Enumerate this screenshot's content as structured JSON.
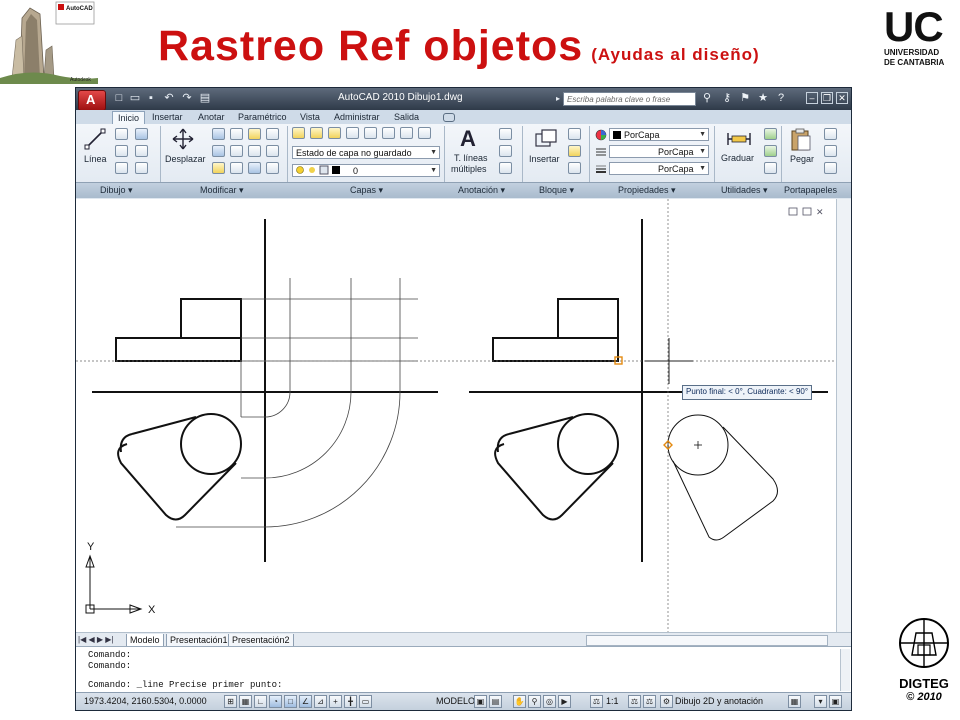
{
  "slide": {
    "title": "Rastreo Ref objetos",
    "subtitle": "(Ayudas al diseño)",
    "autocad_logo_text": "AutoCAD",
    "autocad_logo_subtext": "Autodesk",
    "university": {
      "short": "UC",
      "line1": "UNIVERSIDAD",
      "line2": "DE CANTABRIA"
    },
    "footer": {
      "dept": "DIGTEG",
      "year": "© 2010"
    }
  },
  "app": {
    "title": "AutoCAD 2010    Dibujo1.dwg",
    "search_placeholder": "Escriba palabra clave o frase",
    "tabs": [
      "Inicio",
      "Insertar",
      "Anotar",
      "Paramétrico",
      "Vista",
      "Administrar",
      "Salida"
    ],
    "active_tab": "Inicio"
  },
  "ribbon": {
    "line_label": "Línea",
    "move_label": "Desplazar",
    "layer_state": "Estado de capa no guardado",
    "layer_current": "0",
    "text_label_1": "T. líneas",
    "text_label_2": "múltiples",
    "insert_label": "Insertar",
    "color_value": "PorCapa",
    "linetype_value": "PorCapa",
    "lineweight_value": "PorCapa",
    "measure_label": "Graduar",
    "paste_label": "Pegar",
    "panels": [
      "Dibujo",
      "Modificar",
      "Capas",
      "Anotación",
      "Bloque",
      "Propiedades",
      "Utilidades",
      "Portapapeles"
    ]
  },
  "drawing": {
    "tooltip": "Punto final: < 0°,  Cuadrante: < 90°",
    "ucs_x": "X",
    "ucs_y": "Y"
  },
  "layout_tabs": [
    "Modelo",
    "Presentación1",
    "Presentación2"
  ],
  "command_lines": [
    "Comando:",
    "Comando:",
    "Comando:  _line Precise primer punto:"
  ],
  "status": {
    "coords": "1973.4204, 2160.5304, 0.0000",
    "model": "MODELO",
    "scale": "1:1",
    "workspace": "Dibujo 2D y anotación"
  }
}
